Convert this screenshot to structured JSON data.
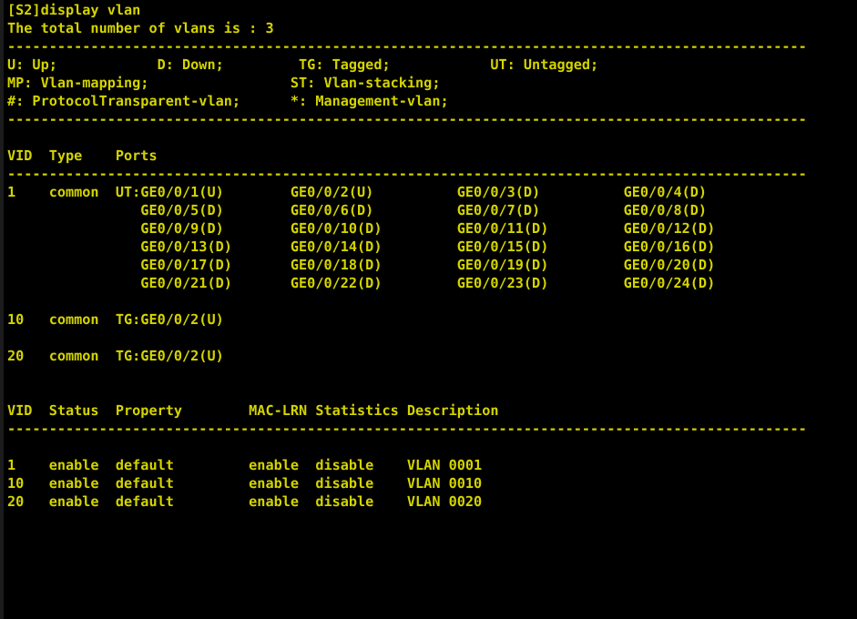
{
  "terminal": {
    "background_color": "#000000",
    "text_color": "#d4d400",
    "gutter_color": "#1c1c1c",
    "prompt_line": "[S2]display vlan",
    "total_line": "The total number of vlans is : 3",
    "separator_short": "----------------------------------------------------------------------------",
    "separator_full": "------------------------------------------------------------------------------------------------",
    "legend": {
      "line1": "U: Up;            D: Down;         TG: Tagged;            UT: Untagged;",
      "line2": "MP: Vlan-mapping;                 ST: Vlan-stacking;",
      "line3": "#: ProtocolTransparent-vlan;      *: Management-vlan;",
      "entries": [
        {
          "abbr": "U",
          "meaning": "Up"
        },
        {
          "abbr": "D",
          "meaning": "Down"
        },
        {
          "abbr": "TG",
          "meaning": "Tagged"
        },
        {
          "abbr": "UT",
          "meaning": "Untagged"
        },
        {
          "abbr": "MP",
          "meaning": "Vlan-mapping"
        },
        {
          "abbr": "ST",
          "meaning": "Vlan-stacking"
        },
        {
          "abbr": "#",
          "meaning": "ProtocolTransparent-vlan"
        },
        {
          "abbr": "*",
          "meaning": "Management-vlan"
        }
      ]
    },
    "ports_table": {
      "header": "VID  Type    Ports",
      "columns": [
        "VID",
        "Type",
        "Ports"
      ],
      "rows": [
        {
          "vid": "1",
          "type": "common",
          "tag_mode": "UT",
          "lines": [
            "1    common  UT:GE0/0/1(U)        GE0/0/2(U)          GE0/0/3(D)          GE0/0/4(D)",
            "                GE0/0/5(D)        GE0/0/6(D)          GE0/0/7(D)          GE0/0/8(D)",
            "                GE0/0/9(D)        GE0/0/10(D)         GE0/0/11(D)         GE0/0/12(D)",
            "                GE0/0/13(D)       GE0/0/14(D)         GE0/0/15(D)         GE0/0/16(D)",
            "                GE0/0/17(D)       GE0/0/18(D)         GE0/0/19(D)         GE0/0/20(D)",
            "                GE0/0/21(D)       GE0/0/22(D)         GE0/0/23(D)         GE0/0/24(D)"
          ],
          "ports": [
            "GE0/0/1(U)",
            "GE0/0/2(U)",
            "GE0/0/3(D)",
            "GE0/0/4(D)",
            "GE0/0/5(D)",
            "GE0/0/6(D)",
            "GE0/0/7(D)",
            "GE0/0/8(D)",
            "GE0/0/9(D)",
            "GE0/0/10(D)",
            "GE0/0/11(D)",
            "GE0/0/12(D)",
            "GE0/0/13(D)",
            "GE0/0/14(D)",
            "GE0/0/15(D)",
            "GE0/0/16(D)",
            "GE0/0/17(D)",
            "GE0/0/18(D)",
            "GE0/0/19(D)",
            "GE0/0/20(D)",
            "GE0/0/21(D)",
            "GE0/0/22(D)",
            "GE0/0/23(D)",
            "GE0/0/24(D)"
          ]
        },
        {
          "vid": "10",
          "type": "common",
          "tag_mode": "TG",
          "lines": [
            "10   common  TG:GE0/0/2(U)"
          ],
          "ports": [
            "GE0/0/2(U)"
          ]
        },
        {
          "vid": "20",
          "type": "common",
          "tag_mode": "TG",
          "lines": [
            "20   common  TG:GE0/0/2(U)"
          ],
          "ports": [
            "GE0/0/2(U)"
          ]
        }
      ]
    },
    "status_table": {
      "header": "VID  Status  Property        MAC-LRN Statistics Description",
      "columns": [
        "VID",
        "Status",
        "Property",
        "MAC-LRN",
        "Statistics",
        "Description"
      ],
      "rows": [
        {
          "line": "1    enable  default         enable  disable    VLAN 0001",
          "vid": "1",
          "status": "enable",
          "property": "default",
          "mac_lrn": "enable",
          "statistics": "disable",
          "description": "VLAN 0001"
        },
        {
          "line": "10   enable  default         enable  disable    VLAN 0010",
          "vid": "10",
          "status": "enable",
          "property": "default",
          "mac_lrn": "enable",
          "statistics": "disable",
          "description": "VLAN 0010"
        },
        {
          "line": "20   enable  default         enable  disable    VLAN 0020",
          "vid": "20",
          "status": "enable",
          "property": "default",
          "mac_lrn": "enable",
          "statistics": "disable",
          "description": "VLAN 0020"
        }
      ]
    }
  }
}
